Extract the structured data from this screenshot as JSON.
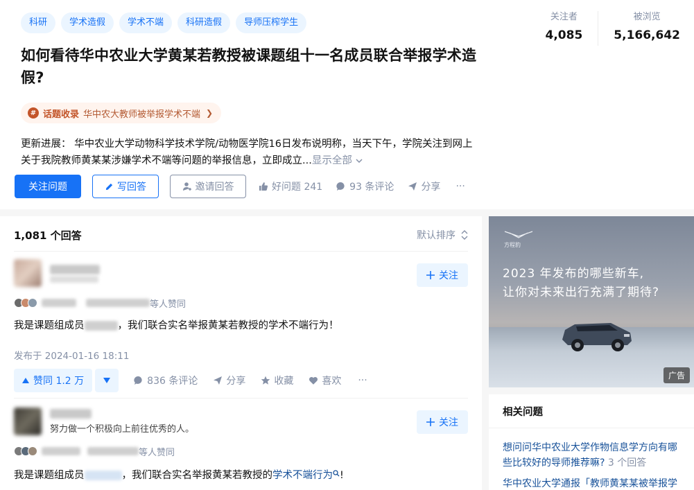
{
  "colors": {
    "brand": "#1772f6",
    "meta": "#8590a6",
    "collect": "#c3552a"
  },
  "question": {
    "topics": [
      "科研",
      "学术造假",
      "学术不端",
      "科研造假",
      "导师压榨学生"
    ],
    "title": "如何看待华中农业大学黄某若教授被课题组十一名成员联合举报学术造假?",
    "collection": {
      "tag": "话题收录",
      "text": "华中农大教师被举报学术不端",
      "arrow": "❯"
    },
    "excerpt_line1": "更新进展： 华中农业大学动物科学技术学院/动物医学院16日发布说明称，当天下午，学院关注到网上",
    "excerpt_line2": "关于我院教师黄某某涉嫌学术不端等问题的举报信息，立即成立...",
    "show_all": "显示全部",
    "buttons": {
      "follow": "关注问题",
      "write": "写回答",
      "invite": "邀请回答",
      "good": "好问题 241",
      "comments": "93 条评论",
      "share": "分享",
      "more": "···"
    }
  },
  "stats": {
    "followers_label": "关注者",
    "followers_value": "4,085",
    "views_label": "被浏览",
    "views_value": "5,166,642"
  },
  "answers": {
    "count": "1,081 个回答",
    "sort": "默认排序",
    "items": [
      {
        "follow": "关注",
        "voters_suffix": "等人赞同",
        "content_prefix": "我是课题组成员",
        "content_suffix": "，我们联合实名举报黄某若教授的学术不端行为！",
        "date": "发布于 2024-01-16 18:11",
        "vote": "赞同 1.2 万",
        "comments": "836 条评论",
        "share": "分享",
        "collect": "收藏",
        "like": "喜欢",
        "more": "···"
      },
      {
        "follow": "关注",
        "bio": "努力做一个积极向上前往优秀的人。",
        "voters_suffix": "等人赞同",
        "content_prefix": "我是课题组成员",
        "content_mid": "，我们联合实名举报黄某若教授的",
        "content_link": "学术不端行为",
        "content_end": "!"
      }
    ]
  },
  "ad": {
    "logo": "方程豹",
    "line1": "2023 年发布的哪些新车,",
    "line2": "让你对未来出行充满了期待?",
    "tag": "广告"
  },
  "related": {
    "title": "相关问题",
    "items": [
      {
        "line1": "想问问华中农业大学作物信息学方向有哪",
        "line2": "些比较好的导师推荐嘛?",
        "count": "3 个回答"
      },
      {
        "line1": "华中农业大学通报「教师黄某某被举报学",
        "line2": ""
      }
    ]
  }
}
